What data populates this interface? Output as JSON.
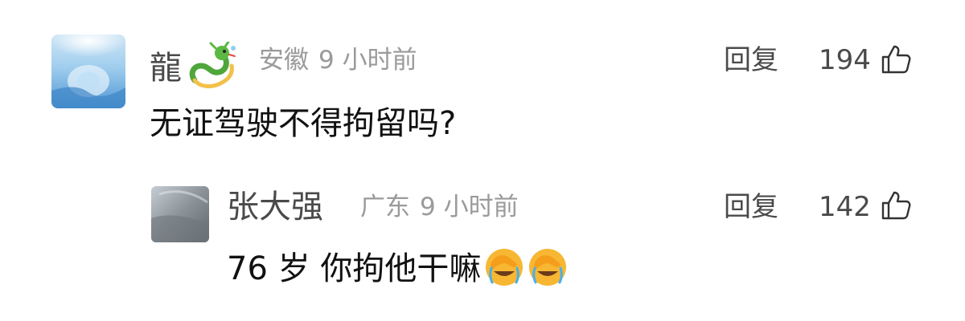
{
  "comments": [
    {
      "username": "龍",
      "location": "安徽",
      "time": "9 小时前",
      "reply_label": "回复",
      "likes": "194",
      "content": "无证驾驶不得拘留吗?",
      "username_badge_icon": "dragon-emoji",
      "avatar_icon": "blue-scenery-avatar"
    },
    {
      "username": "张大强",
      "location": "广东",
      "time": "9 小时前",
      "reply_label": "回复",
      "likes": "142",
      "content": "76 岁  你拘他干嘛",
      "content_emoji": [
        "face-palm-crying-emoji",
        "face-palm-crying-emoji"
      ],
      "avatar_icon": "gray-blurred-avatar"
    }
  ],
  "colors": {
    "username": "#4a4a4a",
    "meta": "#9a9a9a",
    "content": "#111111",
    "background": "#ffffff",
    "emoji_yellow": "#f7b733"
  }
}
